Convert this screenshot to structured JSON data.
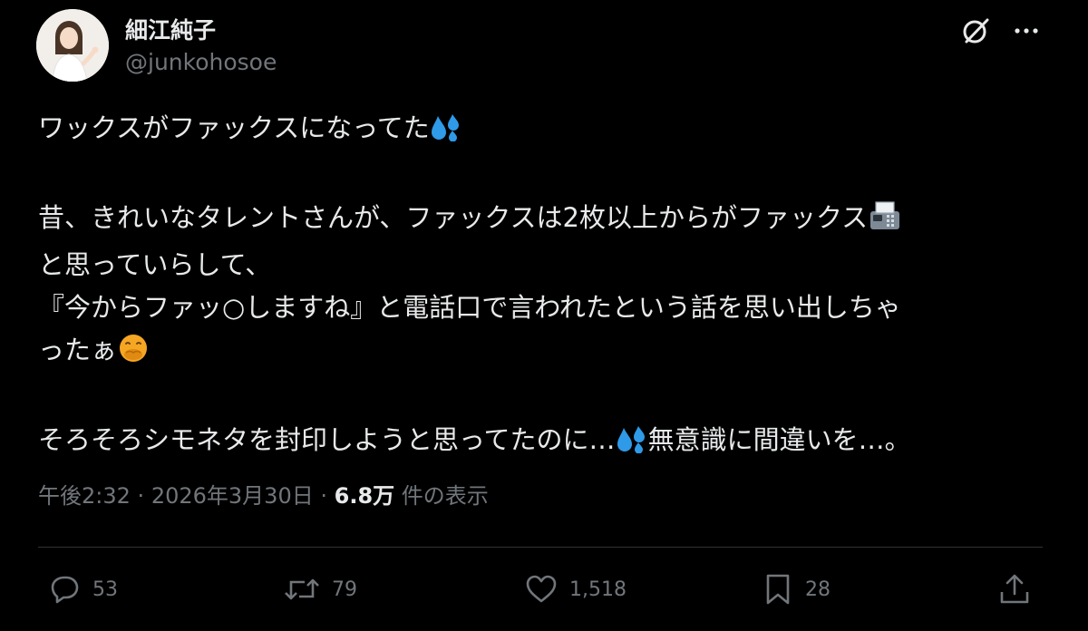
{
  "author": {
    "display_name": "細江純子",
    "handle": "@junkohosoe"
  },
  "header_icons": {
    "grok": "grok-icon",
    "more": "more-icon"
  },
  "tweet": {
    "lines": [
      "ワックスがファックスになってた",
      "昔、きれいなタレントさんが、ファックスは2枚以上からがファックス",
      "と思っていらして、",
      "『今からファッ○しますね』と電話口で言われたという話を思い出しちゃ",
      "ったぁ",
      "そろそろシモネタを封印しようと思ってたのに…",
      "無意識に間違いを…。"
    ],
    "emojis": [
      "sweat-drops-emoji",
      "fax-emoji",
      "hand-over-mouth-emoji",
      "sweat-drops-emoji"
    ]
  },
  "meta": {
    "time": "午後2:32",
    "separator": "·",
    "date": "2026年3月30日",
    "views_count": "6.8万",
    "views_label": "件の表示"
  },
  "actions": {
    "reply_count": "53",
    "repost_count": "79",
    "like_count": "1,518",
    "bookmark_count": "28"
  },
  "colors": {
    "background": "#000000",
    "text": "#e7e9ea",
    "secondary_text": "#71767b",
    "divider": "#2f3336",
    "sweat_emoji": "#2f9ae8",
    "hand_emoji": "#f5a623"
  }
}
